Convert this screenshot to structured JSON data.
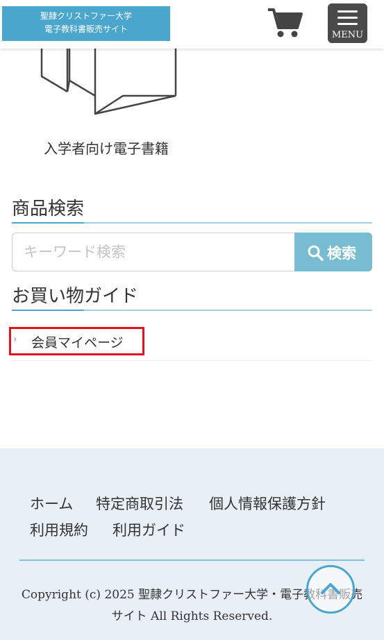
{
  "header": {
    "logo_line1": "聖隷クリストファー大学",
    "logo_line2": "電子教科書販売サイト",
    "cart_icon": "cart-icon",
    "menu_label": "MENU"
  },
  "book": {
    "caption": "入学者向け電子書籍"
  },
  "search": {
    "title": "商品検索",
    "placeholder": "キーワード検索",
    "button_label": "検索"
  },
  "guide": {
    "title": "お買い物ガイド",
    "items": [
      {
        "label": "会員マイページ",
        "icon": "chevron-right-icon"
      }
    ]
  },
  "footer": {
    "links": [
      "ホーム",
      "特定商取引法",
      "個人情報保護方針",
      "利用規約",
      "利用ガイド"
    ],
    "copyright": "Copyright (c) 2025 聖隷クリストファー大学・電子教科書販売サイト All Rights Reserved."
  },
  "colors": {
    "brand": "#4aa6cc",
    "search_button": "#78bcd1",
    "menu_button": "#4a4a4a",
    "footer_bg": "#e8eff5",
    "highlight": "#e0141e"
  }
}
